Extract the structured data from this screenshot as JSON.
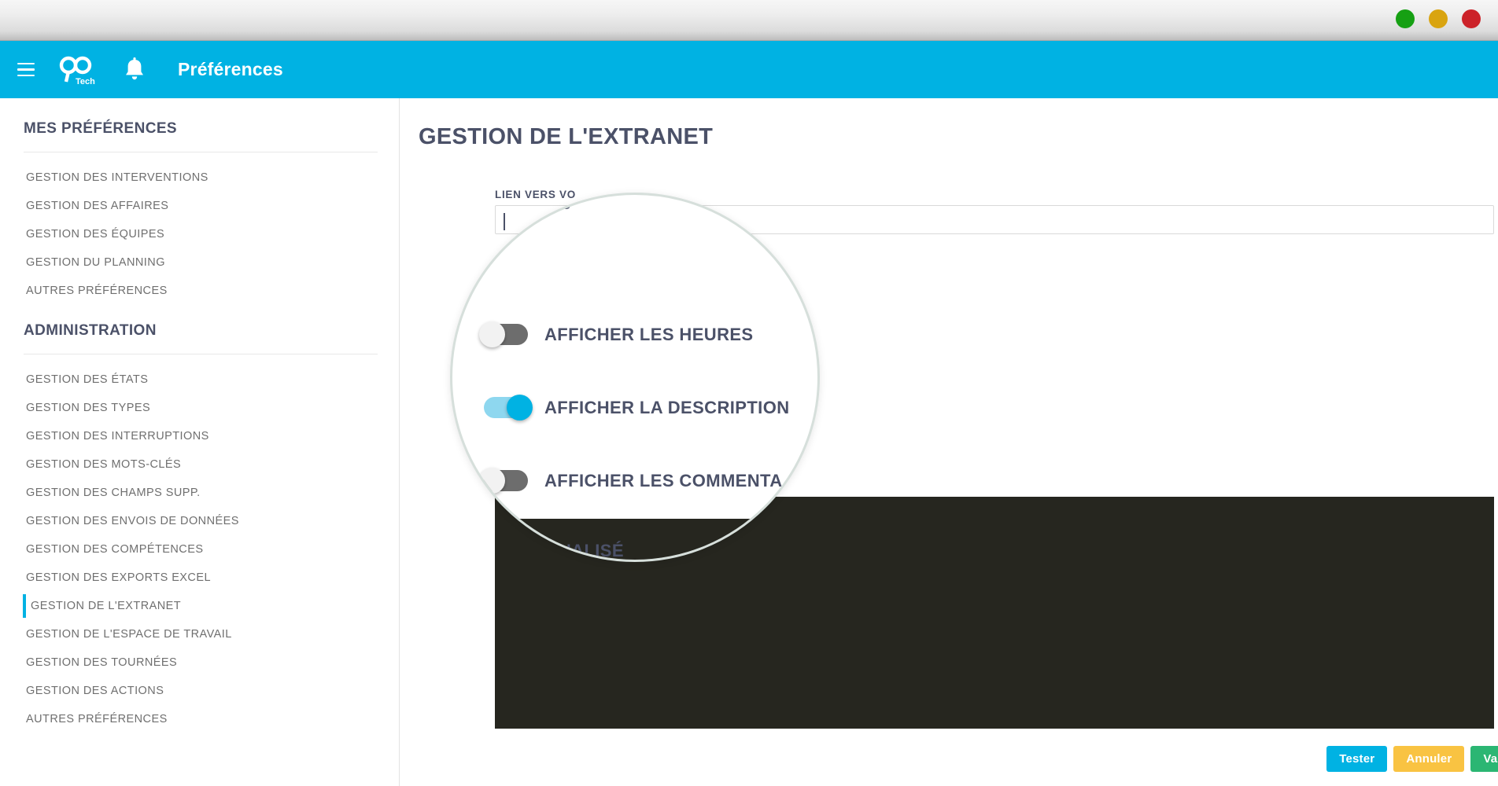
{
  "window": {
    "controls": [
      {
        "name": "minimize",
        "color": "#16a013"
      },
      {
        "name": "maximize",
        "color": "#d9a410"
      },
      {
        "name": "close",
        "color": "#cc2229"
      }
    ]
  },
  "appbar": {
    "menu_icon": "hamburger-icon",
    "logo": "90tech-logo",
    "logo_text_top": "90",
    "logo_text_bottom": "Tech",
    "notification_icon": "bell-icon",
    "title": "Préférences"
  },
  "sidebar": {
    "sections": [
      {
        "title": "MES PRÉFÉRENCES",
        "items": [
          {
            "label": "GESTION DES INTERVENTIONS",
            "active": false
          },
          {
            "label": "GESTION DES AFFAIRES",
            "active": false
          },
          {
            "label": "GESTION DES ÉQUIPES",
            "active": false
          },
          {
            "label": "GESTION DU PLANNING",
            "active": false
          },
          {
            "label": "AUTRES PRÉFÉRENCES",
            "active": false
          }
        ]
      },
      {
        "title": "ADMINISTRATION",
        "items": [
          {
            "label": "GESTION DES ÉTATS",
            "active": false
          },
          {
            "label": "GESTION DES TYPES",
            "active": false
          },
          {
            "label": "GESTION DES INTERRUPTIONS",
            "active": false
          },
          {
            "label": "GESTION DES MOTS-CLÉS",
            "active": false
          },
          {
            "label": "GESTION DES CHAMPS SUPP.",
            "active": false
          },
          {
            "label": "GESTION DES ENVOIS DE DONNÉES",
            "active": false
          },
          {
            "label": "GESTION DES COMPÉTENCES",
            "active": false
          },
          {
            "label": "GESTION DES EXPORTS EXCEL",
            "active": false
          },
          {
            "label": "GESTION DE L'EXTRANET",
            "active": true
          },
          {
            "label": "GESTION DE L'ESPACE DE TRAVAIL",
            "active": false
          },
          {
            "label": "GESTION DES TOURNÉES",
            "active": false
          },
          {
            "label": "GESTION DES ACTIONS",
            "active": false
          },
          {
            "label": "AUTRES PRÉFÉRENCES",
            "active": false
          }
        ]
      }
    ]
  },
  "main": {
    "page_title": "GESTION DE L'EXTRANET",
    "field_label_visible": "LIEN VERS VO",
    "field_label_full": "LIEN VERS VOTRE EXTRANET",
    "link_input_value": "",
    "link_input_placeholder": ""
  },
  "magnifier": {
    "field_label": "LIEN VERS VO",
    "rows": [
      {
        "label": "AFFICHER LES HEURES",
        "state": "off"
      },
      {
        "label": "AFFICHER LA DESCRIPTION",
        "state": "on"
      },
      {
        "label": "AFFICHER LES COMMENTA",
        "state": "off"
      }
    ],
    "clipped_label": "SONNALISÉ"
  },
  "actions": {
    "tester": "Tester",
    "annuler": "Annuler",
    "valider": "Valider"
  },
  "colors": {
    "brand_cyan": "#00b2e3",
    "text_dark": "#4b5168",
    "toggle_off": "#6d6d6d",
    "toggle_on_track": "#8ed7ef",
    "dark_panel": "#26261f",
    "warning": "#f9c342",
    "success": "#2bb673"
  }
}
